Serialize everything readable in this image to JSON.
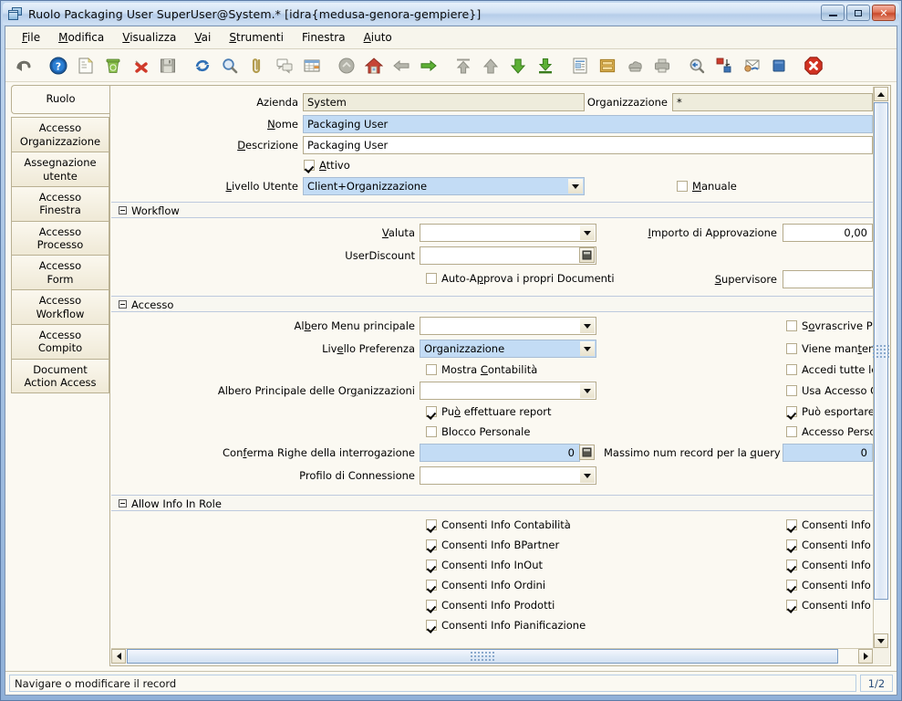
{
  "window": {
    "title": "Ruolo  Packaging User  SuperUser@System.* [idra{medusa-genora-gempiere}]",
    "icon": "window-icon",
    "minimize_label": "–",
    "maximize_label": "□",
    "close_label": "✕"
  },
  "menu": {
    "items": [
      {
        "label": "File",
        "mnemonic": "F"
      },
      {
        "label": "Modifica",
        "mnemonic": "M"
      },
      {
        "label": "Visualizza",
        "mnemonic": "V"
      },
      {
        "label": "Vai",
        "mnemonic": "V"
      },
      {
        "label": "Strumenti",
        "mnemonic": "S"
      },
      {
        "label": "Finestra",
        "mnemonic": ""
      },
      {
        "label": "Aiuto",
        "mnemonic": "A"
      }
    ]
  },
  "toolbar": {
    "buttons": [
      {
        "name": "undo-icon",
        "tooltip": "Annulla"
      },
      {
        "name": "help-icon",
        "tooltip": "Aiuto"
      },
      {
        "name": "new-record-icon",
        "tooltip": "Nuovo"
      },
      {
        "name": "delete-icon",
        "tooltip": "Elimina"
      },
      {
        "name": "delete-selection-icon",
        "tooltip": "Elimina selezione"
      },
      {
        "name": "save-icon",
        "tooltip": "Salva"
      },
      {
        "name": "refresh-icon",
        "tooltip": "Aggiorna"
      },
      {
        "name": "find-icon",
        "tooltip": "Cerca"
      },
      {
        "name": "attachment-icon",
        "tooltip": "Allegato"
      },
      {
        "name": "chat-icon",
        "tooltip": "Note"
      },
      {
        "name": "grid-toggle-icon",
        "tooltip": "Griglia"
      },
      {
        "name": "history-icon",
        "tooltip": "Cronologia"
      },
      {
        "name": "home-icon",
        "tooltip": "Home"
      },
      {
        "name": "arrow-left-icon",
        "tooltip": "Precedente"
      },
      {
        "name": "arrow-right-icon",
        "tooltip": "Successivo"
      },
      {
        "name": "first-record-icon",
        "tooltip": "Primo record"
      },
      {
        "name": "previous-record-icon",
        "tooltip": "Record precedente"
      },
      {
        "name": "next-record-icon",
        "tooltip": "Record successivo"
      },
      {
        "name": "last-record-icon",
        "tooltip": "Ultimo record"
      },
      {
        "name": "report-icon",
        "tooltip": "Report"
      },
      {
        "name": "archive-icon",
        "tooltip": "Archivio"
      },
      {
        "name": "print-preview-icon",
        "tooltip": "Anteprima di stampa"
      },
      {
        "name": "print-icon",
        "tooltip": "Stampa"
      },
      {
        "name": "zoom-back-icon",
        "tooltip": "Zoom indietro"
      },
      {
        "name": "active-workflow-icon",
        "tooltip": "Workflow attivo"
      },
      {
        "name": "request-icon",
        "tooltip": "Richiesta"
      },
      {
        "name": "product-info-icon",
        "tooltip": "Info prodotto"
      },
      {
        "name": "exit-icon",
        "tooltip": "Esci"
      }
    ]
  },
  "sidebar": {
    "selected_tab": "Ruolo",
    "tabs": [
      {
        "label": "Ruolo",
        "selected": true
      },
      {
        "label": "Accesso\nOrganizzazione",
        "selected": false
      },
      {
        "label": "Assegnazione\nutente",
        "selected": false
      },
      {
        "label": "Accesso\nFinestra",
        "selected": false
      },
      {
        "label": "Accesso\nProcesso",
        "selected": false
      },
      {
        "label": "Accesso\nForm",
        "selected": false
      },
      {
        "label": "Accesso\nWorkflow",
        "selected": false
      },
      {
        "label": "Accesso\nCompito",
        "selected": false
      },
      {
        "label": "Document\nAction Access",
        "selected": false
      }
    ]
  },
  "form": {
    "header": {
      "azienda_label": "Azienda",
      "azienda_value": "System",
      "organizzazione_label": "Organizzazione",
      "organizzazione_value": "*",
      "nome_label": "Nome",
      "nome_value": "Packaging User",
      "descrizione_label": "Descrizione",
      "descrizione_value": "Packaging User",
      "attivo_label": "Attivo",
      "attivo_checked": true,
      "livello_utente_label": "Livello Utente",
      "livello_utente_value": "Client+Organizzazione",
      "manuale_label": "Manuale",
      "manuale_checked": false
    },
    "workflow": {
      "section_title": "Workflow",
      "valuta_label": "Valuta",
      "valuta_value": "",
      "userdiscount_label": "UserDiscount",
      "userdiscount_value": "",
      "auto_approva_label": "Auto-Approva i propri Documenti",
      "auto_approva_checked": false,
      "importo_label": "Importo di Approvazione",
      "importo_value": "0,00",
      "supervisore_label": "Supervisore",
      "supervisore_value": ""
    },
    "accesso": {
      "section_title": "Accesso",
      "albero_menu_label": "Albero Menu principale",
      "albero_menu_value": "",
      "livello_preferenza_label": "Livello Preferenza",
      "livello_preferenza_value": "Organizzazione",
      "mostra_contabilita_label": "Mostra Contabilità",
      "mostra_contabilita_checked": false,
      "albero_principale_label": "Albero Principale delle Organizzazioni",
      "albero_principale_value": "",
      "puo_report_label": "Può effettuare report",
      "puo_report_checked": true,
      "blocco_personale_label": "Blocco Personale",
      "blocco_personale_checked": false,
      "conferma_righe_label": "Conferma Righe della interrogazione",
      "conferma_righe_value": "0",
      "profilo_connessione_label": "Profilo di Connessione",
      "profilo_connessione_value": "",
      "sovrascrive_label": "Sovrascrive Prezzo Limite",
      "sovrascrive_checked": false,
      "log_modifiche_label": "Viene mantenuto il Log delle modifich",
      "log_modifiche_checked": false,
      "accedi_tutte_label": "Accedi tutte le Organizzazioni",
      "accedi_tutte_checked": false,
      "usa_accesso_label": "Usa Accesso Organizzazione dell'Uter",
      "usa_accesso_checked": false,
      "puo_esportare_label": "Può esportare",
      "puo_esportare_checked": true,
      "accesso_personale_label": "Accesso Personale",
      "accesso_personale_checked": false,
      "massimo_num_label": "Massimo num record per la query",
      "massimo_num_value": "0"
    },
    "allow_info": {
      "section_title": "Allow Info In Role",
      "left_column": [
        {
          "label": "Consenti Info Contabilità",
          "checked": true
        },
        {
          "label": "Consenti Info BPartner",
          "checked": true
        },
        {
          "label": "Consenti Info InOut",
          "checked": true
        },
        {
          "label": "Consenti Info Ordini",
          "checked": true
        },
        {
          "label": "Consenti Info Prodotti",
          "checked": true
        },
        {
          "label": "Consenti Info Pianificazione",
          "checked": true
        }
      ],
      "right_column": [
        {
          "label": "Consenti Info Asset",
          "checked": true
        },
        {
          "label": "Consenti Info Giornale Cassa",
          "checked": true
        },
        {
          "label": "Consenti Info Fatture",
          "checked": true
        },
        {
          "label": "Consenti Info Pagamenti",
          "checked": true
        },
        {
          "label": "Consenti Info Risorse",
          "checked": true
        }
      ]
    }
  },
  "status_bar": {
    "message": "Navigare o modificare il record",
    "record_counter": "1/2"
  },
  "colors": {
    "focus_field": "#c3dcf5",
    "readonly_field": "#eeecdc",
    "panel_bg": "#fbf9f2",
    "title_bar": "#cfe0f3",
    "close_button": "#c9492c"
  }
}
